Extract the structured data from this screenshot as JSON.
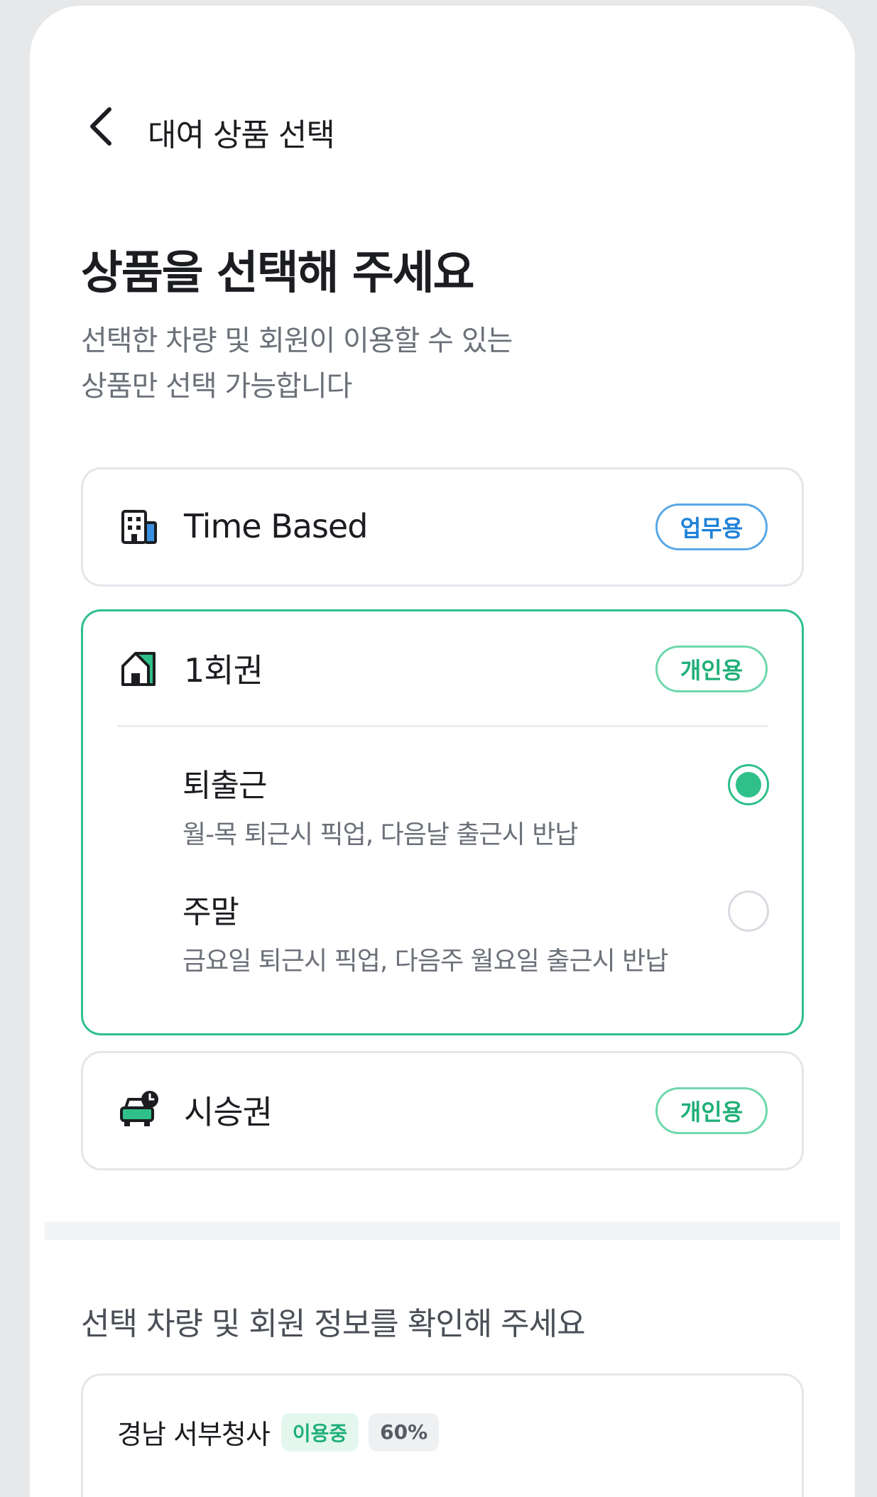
{
  "header": {
    "title": "대여 상품 선택"
  },
  "intro": {
    "title": "상품을 선택해 주세요",
    "desc_line1": "선택한 차량 및 회원이 이용할 수 있는",
    "desc_line2": "상품만 선택 가능합니다"
  },
  "products": {
    "time_based": {
      "title": "Time Based",
      "badge": "업무용",
      "icon": "building-icon"
    },
    "one_time": {
      "title": "1회권",
      "badge": "개인용",
      "icon": "house-icon",
      "options": [
        {
          "title": "퇴출근",
          "desc": "월-목 퇴근시 픽업, 다음날 출근시 반납",
          "selected": true
        },
        {
          "title": "주말",
          "desc": "금요일 퇴근시 픽업, 다음주 월요일 출근시 반납",
          "selected": false
        }
      ]
    },
    "test_drive": {
      "title": "시승권",
      "badge": "개인용",
      "icon": "car-clock-icon"
    }
  },
  "confirm": {
    "title": "선택 차량 및 회원 정보를 확인해 주세요",
    "member_name": "경남 서부청사",
    "status_tag": "이용중",
    "percent_tag": "60%"
  },
  "colors": {
    "accent": "#2fc08a",
    "work_blue": "#1f82d8"
  }
}
